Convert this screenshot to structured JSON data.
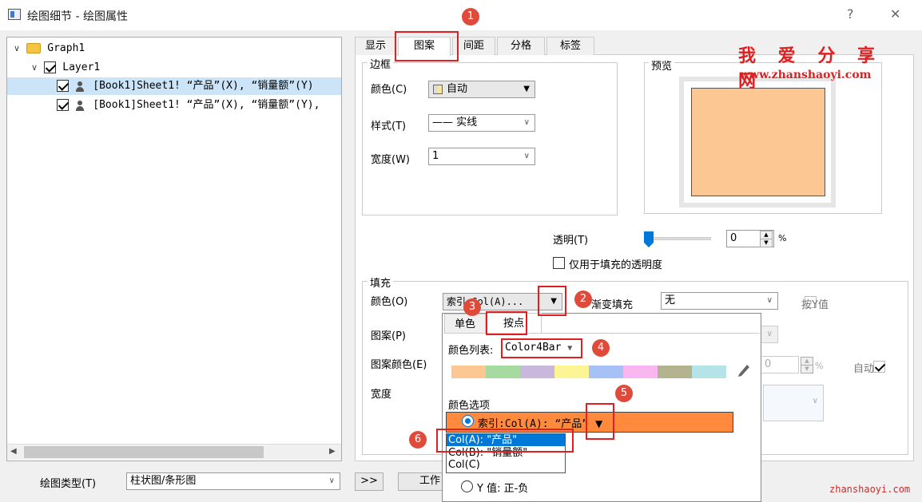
{
  "window": {
    "title": "绘图细节 - 绘图属性",
    "help_label": "?",
    "close_label": "✕"
  },
  "tree": {
    "root": "Graph1",
    "layer": "Layer1",
    "plots": [
      "[Book1]Sheet1! “产品”(X), “销量额”(Y)",
      "[Book1]Sheet1! “产品”(X), “销量额”(Y),"
    ]
  },
  "bottom": {
    "plot_type_label": "绘图类型(T)",
    "plot_type_value": "柱状图/条形图",
    "arrow_button": ">>",
    "work_button": "工作"
  },
  "tabs": [
    "显示",
    "图案",
    "间距",
    "分格",
    "标签"
  ],
  "border": {
    "title": "边框",
    "color_label": "颜色(C)",
    "color_value": "自动",
    "style_label": "样式(T)",
    "style_value": "—— 实线",
    "width_label": "宽度(W)",
    "width_value": "1"
  },
  "preview": {
    "title": "预览",
    "fill_color": "#fdc794"
  },
  "transparency": {
    "label": "透明(T)",
    "value": "0",
    "unit": "%",
    "fill_only_label": "仅用于填充的透明度"
  },
  "fill": {
    "title": "填充",
    "color_label": "颜色(O)",
    "color_value": "索引:Col(A)...",
    "gradient_label": "渐变填充",
    "gradient_value": "无",
    "by_y_label": "按Y值",
    "pattern_label": "图案(P)",
    "pattern_color_label": "图案颜色(E)",
    "width_label": "宽度",
    "auto_label": "自动",
    "pattern_width_value": "0"
  },
  "popup": {
    "tab_single": "单色",
    "tab_by_point": "按点",
    "color_list_label": "颜色列表:",
    "color_list_value": "Color4Bar",
    "colors": [
      "#fdc794",
      "#a5dba0",
      "#c9b8dc",
      "#fdf593",
      "#a6c1f5",
      "#f9b6f0",
      "#b3b48f",
      "#b4e3e8"
    ],
    "options_label": "颜色选项",
    "index_option": "索引:Col(A): “产品”",
    "dropdown_items": [
      "Col(A): \"产品\"",
      "Col(B): \"销量额\"",
      "Col(C)"
    ],
    "y_value_option": "Y 值: 正-负"
  },
  "annotations": {
    "badges": [
      "1",
      "2",
      "3",
      "4",
      "5",
      "6"
    ],
    "site_title": "我 爱 分 享 网",
    "site_url": "www.zhanshaoyi.com",
    "footer_url": "zhanshaoyi.com"
  },
  "colors": {
    "accent_orange": "#ff8a3d",
    "selection_blue": "#0078d7",
    "annotation_red": "#e02020"
  }
}
